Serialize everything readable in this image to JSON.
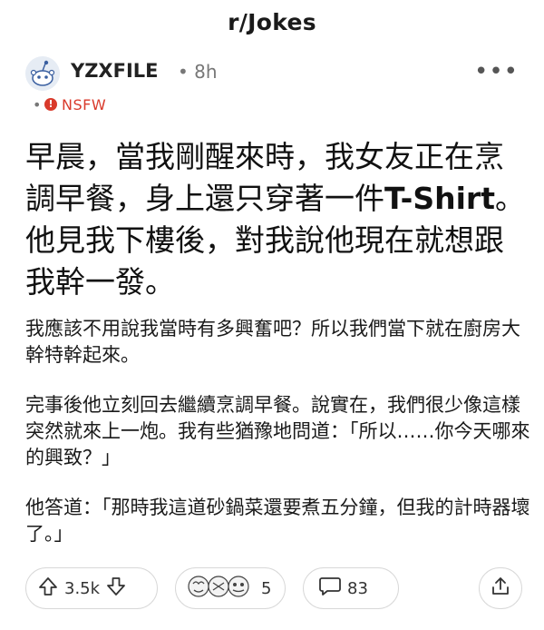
{
  "header": {
    "subreddit": "r/Jokes"
  },
  "post": {
    "author": "YZXFILE",
    "separator": "•",
    "time_ago": "8h",
    "more_label": "•••",
    "nsfw_dot": "•",
    "nsfw_label": "NSFW",
    "title_part1": "早晨，當我剛醒來時，我女友正在烹調早餐，身上還只穿著一件",
    "title_bold": "T-Shirt",
    "title_part2": "。他見我下樓後，對我說他現在就想跟我幹一發。",
    "paragraphs": [
      "我應該不用說我當時有多興奮吧？所以我們當下就在廚房大幹特幹起來。",
      "完事後他立刻回去繼續烹調早餐。說實在，我們很少像這樣突然就來上一炮。我有些猶豫地問道：「所以……你今天哪來的興致？」",
      "他答道：「那時我這道砂鍋菜還要煮五分鐘，但我的計時器壞了。」"
    ]
  },
  "actions": {
    "vote_count": "3.5k",
    "award_count": "5",
    "comment_count": "83"
  },
  "colors": {
    "nsfw": "#d93a2b",
    "border": "#d8d8d8",
    "muted": "#777777"
  },
  "icons": [
    "avatar-snoo-icon",
    "more-icon",
    "nsfw-icon",
    "upvote-icon",
    "downvote-icon",
    "award-icon",
    "comment-icon",
    "share-icon"
  ]
}
